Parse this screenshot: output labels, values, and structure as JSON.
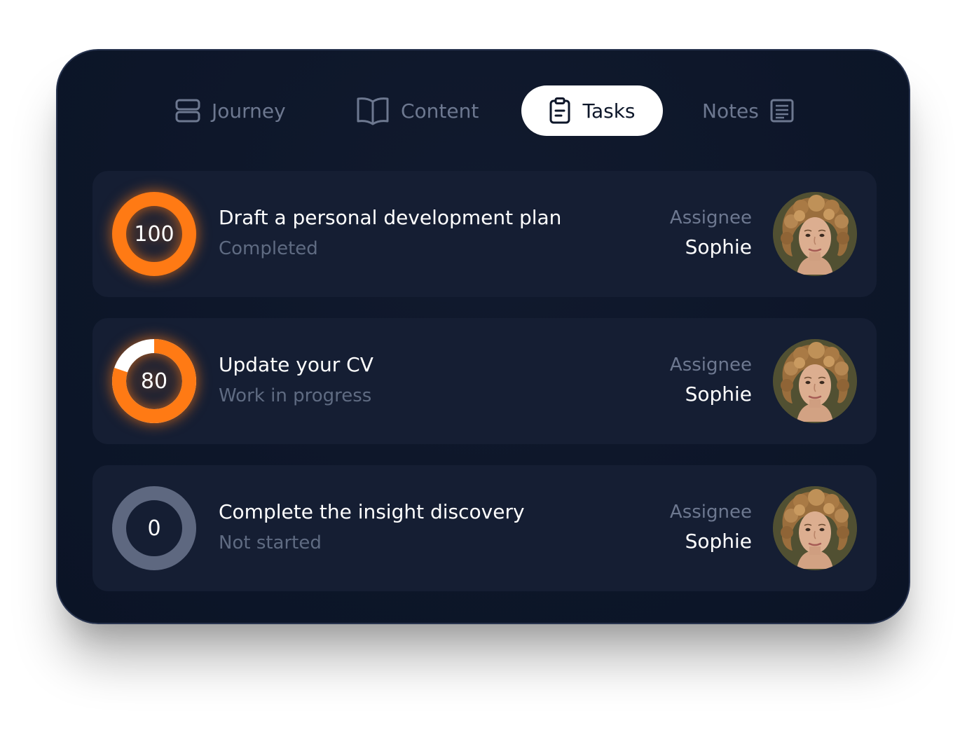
{
  "tabs": [
    {
      "label": "Journey",
      "icon": "journey-icon",
      "active": false
    },
    {
      "label": "Content",
      "icon": "book-icon",
      "active": false
    },
    {
      "label": "Tasks",
      "icon": "clipboard-icon",
      "active": true
    },
    {
      "label": "Notes",
      "icon": "notes-icon",
      "active": false
    }
  ],
  "tasks": [
    {
      "progress": 100,
      "progress_label": "100",
      "title": "Draft a personal development plan",
      "status": "Completed",
      "assignee_label": "Assignee",
      "assignee": "Sophie"
    },
    {
      "progress": 80,
      "progress_label": "80",
      "title": "Update your CV",
      "status": "Work in progress",
      "assignee_label": "Assignee",
      "assignee": "Sophie"
    },
    {
      "progress": 0,
      "progress_label": "0",
      "title": "Complete the insight discovery",
      "status": "Not started",
      "assignee_label": "Assignee",
      "assignee": "Sophie"
    }
  ],
  "colors": {
    "card_background": "#0d1629",
    "row_background": "#151e33",
    "accent": "#ff7a14",
    "ring_track": "#5e6880",
    "ring_remaining": "#ffffff",
    "active_tab_background": "#ffffff"
  }
}
